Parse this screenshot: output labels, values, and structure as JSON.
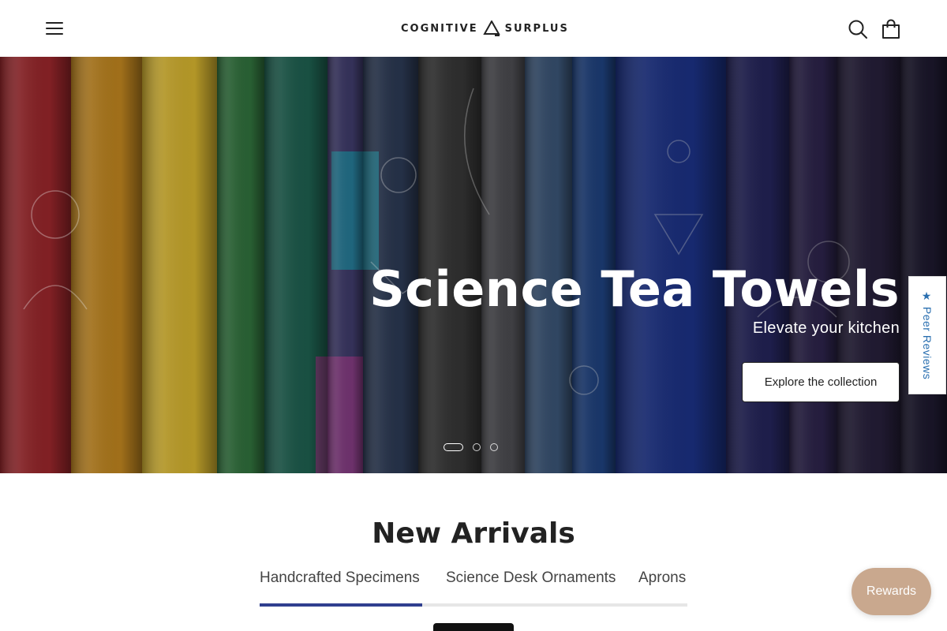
{
  "header": {
    "brand": "COGNITIVE",
    "brand2": "SURPLUS",
    "icons": {
      "menu": "hamburger-menu-icon",
      "search": "search-icon",
      "cart": "shopping-bag-icon"
    }
  },
  "hero": {
    "title": "Science Tea Towels",
    "subtitle": "Elevate your kitchen",
    "cta_label": "Explore the collection",
    "slides": 3,
    "active_slide": 1
  },
  "side_tab": {
    "label": "★ Peer Reviews"
  },
  "new_arrivals": {
    "title": "New Arrivals",
    "tabs": [
      {
        "label": "Handcrafted Specimens",
        "active": true
      },
      {
        "label": "Science Desk Ornaments",
        "active": false
      },
      {
        "label": "Aprons",
        "active": false
      }
    ]
  },
  "rewards": {
    "label": "Rewards"
  },
  "colors": {
    "tab_indicator": "#2f3f8f",
    "rewards_bg": "#c9a88e",
    "side_tab_text": "#2a6fb0"
  }
}
